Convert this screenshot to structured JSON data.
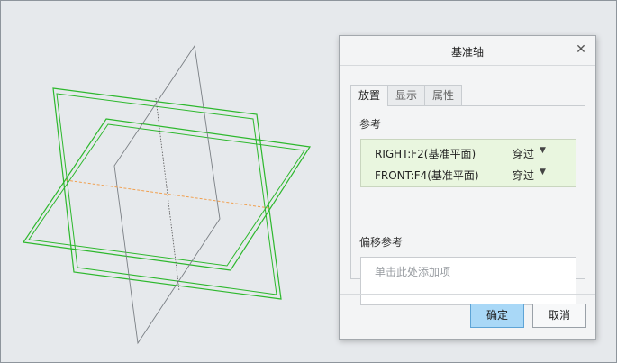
{
  "dialog": {
    "title": "基准轴",
    "tabs": [
      {
        "label": "放置",
        "active": true
      },
      {
        "label": "显示",
        "active": false
      },
      {
        "label": "属性",
        "active": false
      }
    ],
    "references_label": "参考",
    "references": [
      {
        "name": "RIGHT:F2(基准平面)",
        "type": "穿过"
      },
      {
        "name": "FRONT:F4(基准平面)",
        "type": "穿过"
      }
    ],
    "offset_label": "偏移参考",
    "offset_placeholder": "单击此处添加项",
    "ok_label": "确定",
    "cancel_label": "取消"
  },
  "colors": {
    "plane_green": "#2db82d",
    "plane_gray": "#7a7f84",
    "axis_orange": "#f0a050",
    "ok_button": "#a9d8f7",
    "reference_highlight": "#e9f6df"
  }
}
